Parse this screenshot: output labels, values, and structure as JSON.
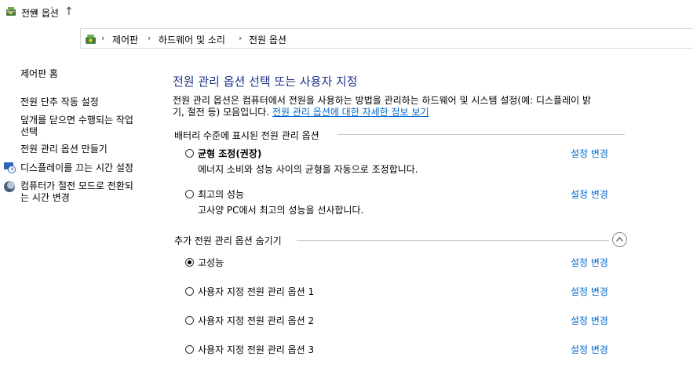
{
  "window": {
    "title": "전원 옵션",
    "icon": "power-options-icon"
  },
  "nav": {
    "back_icon": "back-arrow-icon",
    "forward_icon": "forward-arrow-icon",
    "recent_icon": "chevron-down-icon",
    "up_icon": "up-arrow-icon",
    "back_glyph": "←",
    "forward_glyph": "→",
    "recent_glyph": "˅",
    "up_glyph": "↑"
  },
  "breadcrumb": {
    "separator": "›",
    "items": [
      "제어판",
      "하드웨어 및 소리",
      "전원 옵션"
    ]
  },
  "sidebar": {
    "home": "제어판 홈",
    "links": [
      {
        "label": "전원 단추 작동 설정"
      },
      {
        "label_line1": "덮개를 닫으면 수행되는 작업",
        "label_line2": "선택"
      },
      {
        "label": "전원 관리 옵션 만들기"
      },
      {
        "label": "디스플레이를 끄는 시간 설정",
        "icon": "display-clock-icon"
      },
      {
        "label_line1": "컴퓨터가 절전 모드로 전환되",
        "label_line2": "는 시간 변경",
        "icon": "sleep-moon-icon"
      }
    ]
  },
  "main": {
    "heading": "전원 관리 옵션 선택 또는 사용자 지정",
    "description_line1": "전원 관리 옵션은 컴퓨터에서 전원을 사용하는 방법을 관리하는 하드웨어 및 시스템 설정(예: 디스플레이 밝",
    "description_line2": "기, 절전 등) 모음입니다.",
    "description_link": "전원 관리 옵션에 대한 자세한 정보 보기",
    "battery_section": "배터리 수준에 표시된 전원 관리 옵션",
    "extra_section": "추가 전원 관리 옵션 숨기기",
    "change_label": "설정 변경",
    "plans": [
      {
        "name": "균형 조정(권장)",
        "desc": "에너지 소비와 성능 사이의 균형을 자동으로 조정합니다.",
        "checked": false,
        "bold": true
      },
      {
        "name": "최고의 성능",
        "desc": "고사양 PC에서 최고의 성능을 선사합니다.",
        "checked": false
      },
      {
        "name": "고성능",
        "checked": true
      },
      {
        "name": "사용자 지정 전원 관리 옵션 1",
        "checked": false
      },
      {
        "name": "사용자 지정 전원 관리 옵션 2",
        "checked": false
      },
      {
        "name": "사용자 지정 전원 관리 옵션 3",
        "checked": false
      }
    ]
  },
  "colors": {
    "heading": "#1e3287",
    "link": "#0066cc"
  }
}
